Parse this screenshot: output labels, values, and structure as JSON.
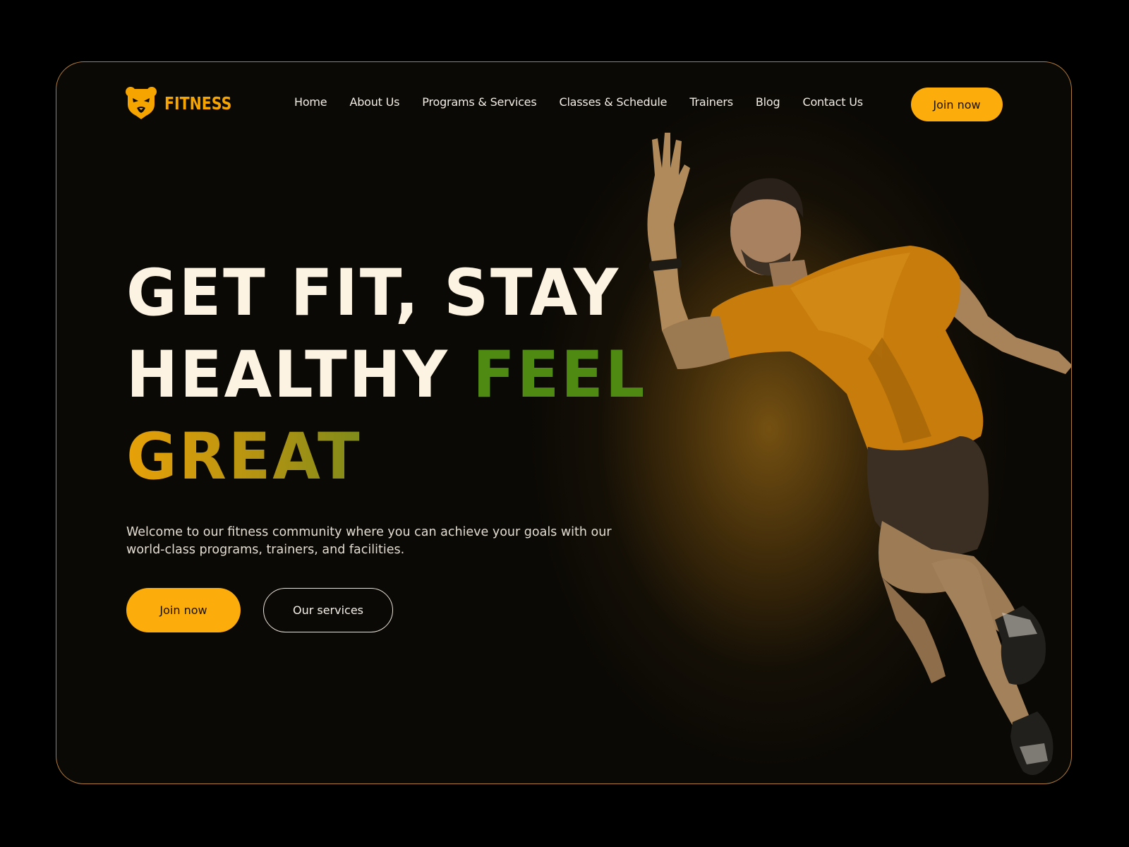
{
  "brand": {
    "name": "FITNESS",
    "logo_icon": "bear-head-icon",
    "accent_color": "#fcac0b"
  },
  "nav": {
    "items": [
      {
        "label": "Home"
      },
      {
        "label": "About Us"
      },
      {
        "label": "Programs & Services"
      },
      {
        "label": "Classes & Schedule"
      },
      {
        "label": "Trainers"
      },
      {
        "label": "Blog"
      },
      {
        "label": "Contact Us"
      }
    ],
    "cta_label": "Join now"
  },
  "hero": {
    "line1": "GET FIT, STAY",
    "line2_white": "HEALTHY",
    "line2_green": "FEEL",
    "line3": "GREAT",
    "subtitle": "Welcome to our fitness community where you can achieve your goals with our world-class programs, trainers, and facilities.",
    "primary_button": "Join now",
    "secondary_button": "Our services",
    "green_color": "#4f8a12",
    "gold_color": "#e8a108"
  }
}
